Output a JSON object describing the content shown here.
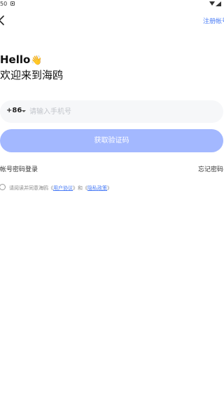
{
  "status_bar": {
    "time": "50",
    "icons": [
      "notification-icon",
      "wifi-icon",
      "signal-icon"
    ]
  },
  "nav": {
    "back_icon": "chevron-left-icon",
    "register_label": "注册帐号"
  },
  "greeting": {
    "hello": "Hello",
    "wave_icon": "👋",
    "welcome": "欢迎来到海鸥"
  },
  "phone": {
    "country_code": "+86",
    "placeholder": "请输入手机号",
    "value": ""
  },
  "actions": {
    "get_code_label": "获取验证码",
    "password_login_label": "帐号密码登录",
    "forgot_password_label": "忘记密码"
  },
  "agreement": {
    "prefix": "请阅读并同意海鸥",
    "open1": "《",
    "user_agreement": "用户协议",
    "close1": "》",
    "and": "和",
    "open2": "《",
    "privacy_policy": "隐私政策",
    "close2": "》"
  },
  "colors": {
    "accent": "#4a7cf6",
    "button_disabled": "#a3b8ff",
    "input_bg": "#f6f7f9"
  }
}
